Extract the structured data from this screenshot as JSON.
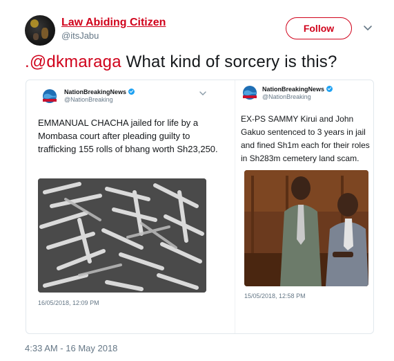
{
  "tweet": {
    "author_name": "Law Abiding Citizen",
    "author_handle": "@itsJabu",
    "follow_label": "Follow",
    "mention": ".@dkmaraga",
    "text": " What kind of sorcery is this?",
    "timestamp": "4:33 AM - 16 May 2018"
  },
  "embedded": [
    {
      "account_name": "NationBreakingNews",
      "account_handle": "@NationBreaking",
      "body": "EMMANUAL CHACHA jailed for life by a Mombasa court after pleading guilty to trafficking 155 rolls of bhang worth Sh23,250.",
      "date": "16/05/2018, 12:09 PM"
    },
    {
      "account_name": "NationBreakingNews",
      "account_handle": "@NationBreaking",
      "body": "EX-PS SAMMY Kirui and John Gakuo sentenced to 3 years in jail and fined Sh1m each for their roles in Sh283m cemetery land scam.",
      "date": "15/05/2018, 12:58 PM"
    }
  ],
  "colors": {
    "accent": "#d0021b",
    "secondary_text": "#657786",
    "verified": "#1da1f2"
  }
}
